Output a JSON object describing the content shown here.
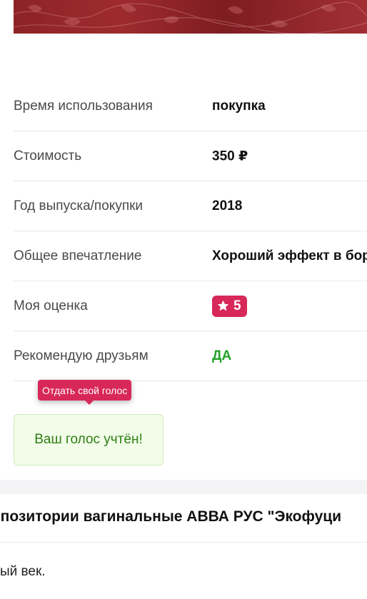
{
  "specs": [
    {
      "label": "Время использования",
      "value": "покупка"
    },
    {
      "label": "Стоимость",
      "value": "350 ₽"
    },
    {
      "label": "Год выпуска/покупки",
      "value": "2018"
    },
    {
      "label": "Общее впечатление",
      "value": "Хороший эффект в бор"
    },
    {
      "label": "Моя оценка",
      "value": "5"
    },
    {
      "label": "Рекомендую друзьям",
      "value": "ДА"
    }
  ],
  "rating_icon": "star-icon",
  "tooltip": "Отдать свой голос",
  "vote_status": "Ваш голос учтён!",
  "product_title": "ппозитории вагинальные АВВА РУС \"Экофуци",
  "body_text": "ый век.",
  "colors": {
    "accent": "#d8285a",
    "yes": "#22a32a",
    "vote_bg": "#f2fde9",
    "vote_text": "#2f7d14"
  }
}
